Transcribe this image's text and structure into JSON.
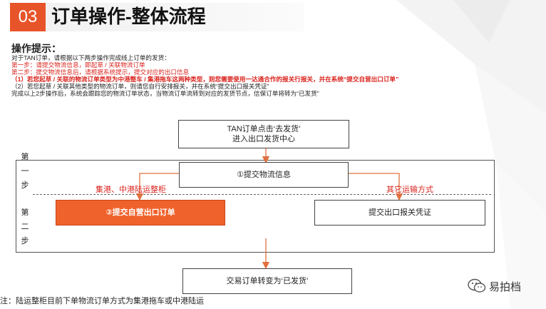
{
  "header": {
    "section_number": "03",
    "title": "订单操作-整体流程"
  },
  "tips": {
    "title": "操作提示：",
    "lines": [
      "对于TAN订单，请根据以下两步操作完成线上订单的发货：",
      "第一步：请提交物流信息，即起草 / 关联物流订单",
      "第二步：提交物流信息后，请根据系统提示，提交对应的出口信息",
      "（1）若您起草 / 关联的物流订单类型为中港整车 / 集港拖车这两种类型，则您需要使用一达通合作的报关行报关，并在系统“提交自营出口订单”",
      "（2）若您起草 / 关联其他类型的物流订单，则请您自行安排报关，并在系统“提交出口报关凭证”",
      "完成以上2步操作后，系统会跟踪您的物流订单状态，当物流订单流转到对应的发货节点，信保订单将转为“已发货”"
    ]
  },
  "flow": {
    "start_box": "TAN订单点击‘去发货’\n进入出口发货中心",
    "step1_box": "①提交物流信息",
    "step2_left_box": "②提交自营出口订单",
    "step2_right_box": "提交出口报关凭证",
    "end_box": "交易订单转变为‘已发货’",
    "left_branch_label": "集港、中港陆运整柜",
    "right_branch_label": "其它运输方式",
    "step1_label": [
      "第",
      "一",
      "步"
    ],
    "step2_label": [
      "第",
      "二",
      "步"
    ]
  },
  "footer": {
    "note": "注：陆运整柜目前下单物流订单方式为集港拖车或中港陆运",
    "logo_text": "易拍档"
  },
  "colors": {
    "accent": "#e8542a",
    "orange_box": "#f0622b",
    "red_text": "#d9231d",
    "arrow": "#e0703f"
  }
}
